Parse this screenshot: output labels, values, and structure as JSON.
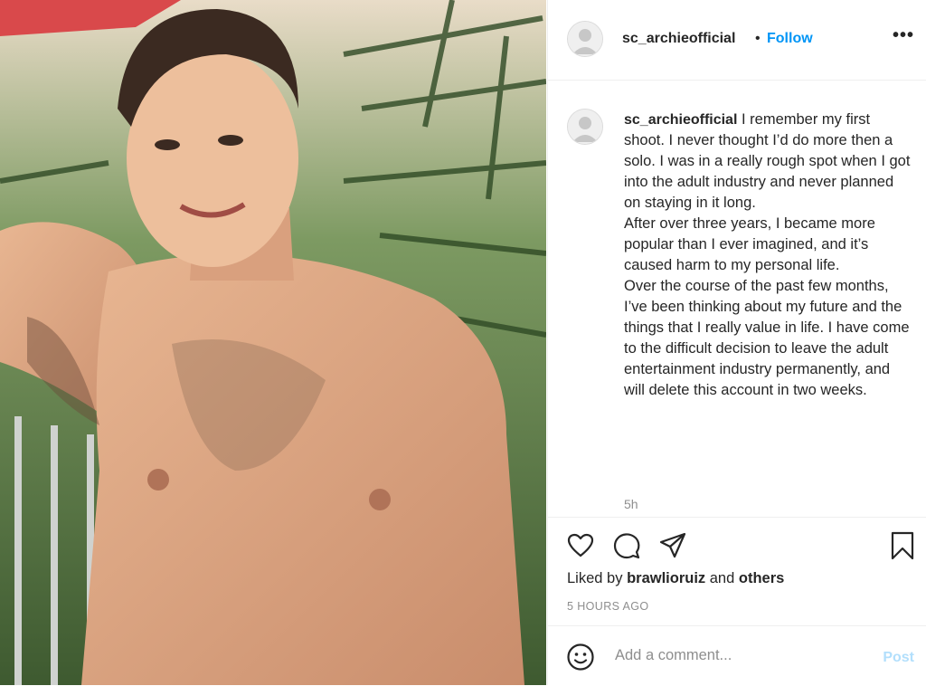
{
  "post": {
    "photo_icon": "photo-of-shirtless-man-icon",
    "header": {
      "username": "sc_archieofficial",
      "separator": "•",
      "follow_label": "Follow",
      "more_icon": "more-options-icon",
      "more_label": "•••"
    },
    "caption": {
      "username": "sc_archieofficial",
      "paragraphs": [
        "I remember my first shoot. I never thought I’d do more then a solo. I was in a really rough spot when I got into the adult industry and never planned on staying in it long.",
        "After over three years, I became more popular than I ever imagined, and it’s caused harm to my personal life.",
        "Over the course of the past few months, I’ve been thinking about my future and the things that I really value in life. I have come to the difficult decision to leave the adult entertainment industry permanently, and will delete this account in two weeks."
      ],
      "time": "5h"
    },
    "actions": {
      "icons": [
        "heart-icon",
        "comment-icon",
        "share-icon",
        "bookmark-icon"
      ],
      "liked_prefix": "Liked by",
      "liked_user": "brawlioruiz",
      "liked_and": "and",
      "liked_others": "others",
      "timestamp": "5 HOURS AGO"
    },
    "comment": {
      "emoji_icon": "emoji-smile-icon",
      "placeholder": "Add a comment...",
      "post_label": "Post"
    },
    "colors": {
      "link_blue": "#0095f6",
      "disabled_blue": "#b2dffc",
      "muted": "#8e8e8e",
      "text": "#262626"
    }
  }
}
